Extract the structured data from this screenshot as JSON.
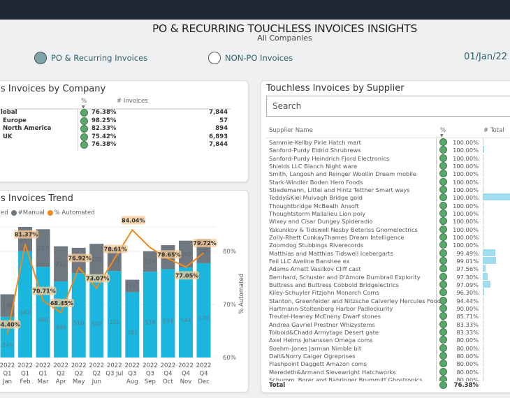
{
  "header": {
    "title": "PO & RECURRING TOUCHLESS INVOICES INSIGHTS",
    "subtitle": "All Companies",
    "date": "01/Jan/22"
  },
  "filters": [
    {
      "label": "PO & Recurring Invoices",
      "selected": true
    },
    {
      "label": "NON-PO Invoices",
      "selected": false
    }
  ],
  "company_panel": {
    "title": "s Invoices by Company",
    "col_pct": "%",
    "col_invoices": "# Invoices",
    "rows": [
      {
        "name": "lobal",
        "pct": "76.38%",
        "invoices": "7,844"
      },
      {
        "name": "Europe",
        "pct": "98.25%",
        "invoices": "57"
      },
      {
        "name": "North America",
        "pct": "82.33%",
        "invoices": "894"
      },
      {
        "name": "UK",
        "pct": "75.42%",
        "invoices": "6,893"
      },
      {
        "name": "",
        "pct": "76.38%",
        "invoices": "7,844"
      }
    ]
  },
  "trend_panel": {
    "title": "s Invoices Trend",
    "legend": [
      {
        "label": "ed",
        "color": "#1ab6dd"
      },
      {
        "label": "#Manual",
        "color": "#6f7880"
      },
      {
        "label": "% Automated",
        "color": "#f08a1c"
      }
    ]
  },
  "chart_data": {
    "type": "bar+line",
    "y2label": "% Automated",
    "y2ticks": [
      "60%",
      "70%",
      "80%"
    ],
    "y2lim": [
      60,
      85
    ],
    "categories": [
      [
        "2022",
        "Q1",
        "Jan"
      ],
      [
        "2022",
        "Q1",
        "Feb"
      ],
      [
        "2022",
        "Q1",
        "Mar"
      ],
      [
        "2022",
        "Q2",
        "Apr"
      ],
      [
        "2022",
        "Q2",
        "May"
      ],
      [
        "2022",
        "Q2",
        "Jun"
      ],
      [
        "2022",
        "Q3 Jul",
        ""
      ],
      [
        "2022",
        "Q3",
        "Aug"
      ],
      [
        "2022",
        "Q3",
        "Sep"
      ],
      [
        "2022",
        "Q4",
        "Oct"
      ],
      [
        "2022",
        "Q4",
        "Nov"
      ],
      [
        "2022",
        "Q4",
        "Dec"
      ]
    ],
    "series": [
      {
        "name": "#Automated",
        "type": "bar",
        "color": "#1ab6dd",
        "values": [
          246,
          642,
          548,
          460,
          510,
          502,
          522,
          395,
          518,
          534,
          544,
          570
        ]
      },
      {
        "name": "#Manual",
        "type": "bar",
        "color": "#6f7880",
        "values": [
          136,
          147,
          227,
          212,
          153,
          185,
          142,
          75,
          124,
          145,
          162,
          145
        ]
      },
      {
        "name": "% Automated",
        "type": "line",
        "color": "#f08a1c",
        "values": [
          64.4,
          81.37,
          70.71,
          68.45,
          76.92,
          73.07,
          78.61,
          84.04,
          80.69,
          78.65,
          77.05,
          79.72
        ],
        "labels": [
          "64.40%",
          "81.37%",
          "70.71%",
          "68.45%",
          "76.92%",
          "73.07%",
          "78.61%",
          "84.04%",
          null,
          "78.65%",
          "77.05%",
          "79.72%"
        ]
      }
    ]
  },
  "supplier_panel": {
    "title": "Touchless Invoices by Supplier",
    "search_placeholder": "Search",
    "col_name": "Supplier Name",
    "col_pct": "%",
    "col_total": "# Total",
    "rows": [
      {
        "name": "Sammie-Kellby Pirie Hatch mart",
        "pct": "100.00%",
        "bar": 0.01
      },
      {
        "name": "Sanford-Purdy Eldrid Shrubrews",
        "pct": "100.00%",
        "bar": 0.03
      },
      {
        "name": "Sanford-Purdy Heindrich Fjord Electronics",
        "pct": "100.00%",
        "bar": 0.01
      },
      {
        "name": "Shields LLC Blanch Night ware",
        "pct": "100.00%",
        "bar": 0.01
      },
      {
        "name": "Smith, Langosh and Reinger Woollin Dream mobile",
        "pct": "100.00%",
        "bar": 0.01
      },
      {
        "name": "Stark-Windler Boden Hero Foods",
        "pct": "100.00%",
        "bar": 0.01
      },
      {
        "name": "Stiedemann, Littel and Hintz Tetther Smart ways",
        "pct": "100.00%",
        "bar": 0.02
      },
      {
        "name": "Teddy&Kiel Mulvagh Bridge gold",
        "pct": "100.00%",
        "bar": 1.0
      },
      {
        "name": "Thoughtbridge McBeath Ansoft",
        "pct": "100.00%",
        "bar": 0.01
      },
      {
        "name": "Thoughtstorm Mallalieu Lion poly",
        "pct": "100.00%",
        "bar": 0.01
      },
      {
        "name": "Wixey and Cisar Dungey Spideradio",
        "pct": "100.00%",
        "bar": 0.01
      },
      {
        "name": "Yakunikov & Tidswell Nesby Beteriss Gnomelectrics",
        "pct": "100.00%",
        "bar": 0.01
      },
      {
        "name": "Zolly-Rhett ConkayThames Dream Intelligence",
        "pct": "100.00%",
        "bar": 0.01
      },
      {
        "name": "Zoomdog Stubbings Riverecords",
        "pct": "100.00%",
        "bar": 0.01
      },
      {
        "name": "Matthias and Matthias Tidswell Icebergarts",
        "pct": "99.49%",
        "bar": 0.3
      },
      {
        "name": "Feil LLC Aveline Banshee ex",
        "pct": "99.01%",
        "bar": 0.32
      },
      {
        "name": "Adams Arnatt Vasilkov Cliff cast",
        "pct": "97.56%",
        "bar": 0.06
      },
      {
        "name": "Bernhard, Schuster and D'Amore Dumbrall Explority",
        "pct": "97.30%",
        "bar": 0.12
      },
      {
        "name": "Buttress and Buttress Cobbold Bridgelectrics",
        "pct": "97.09%",
        "bar": 0.18
      },
      {
        "name": "Kiley-Schuyler Fitzjohn Monarch Coms",
        "pct": "96.30%",
        "bar": 0.03
      },
      {
        "name": "Stanton, Greenfelder and Nitzsche Calverley Hercules Foods",
        "pct": "94.44%",
        "bar": 0.02
      },
      {
        "name": "Hartmann-Stoltenberg Harbor Padlockurity",
        "pct": "90.00%",
        "bar": 0.01
      },
      {
        "name": "Treutel-Heaney McEneny Dwarf stones",
        "pct": "85.71%",
        "bar": 0.01
      },
      {
        "name": "Andrea Gavriel Prestner Whizystems",
        "pct": "83.33%",
        "bar": 0.01
      },
      {
        "name": "Toiboid&Chadd Armytage Desert gate",
        "pct": "83.33%",
        "bar": 0.01
      },
      {
        "name": "Axel Heims Johanssen Omega coms",
        "pct": "80.00%",
        "bar": 0.01
      },
      {
        "name": "Boehm-Jones Jarman Nimble bit",
        "pct": "80.00%",
        "bar": 0.01
      },
      {
        "name": "Dalt&Norry Caiger Ogreprises",
        "pct": "80.00%",
        "bar": 0.01
      },
      {
        "name": "Flashpoint Daggett Amazon coms",
        "pct": "80.00%",
        "bar": 0.01
      },
      {
        "name": "Meredeth&Armand Sievewright Hatchworks",
        "pct": "80.00%",
        "bar": 0.01
      },
      {
        "name": "Schumm, Borer and Bahringer Brummitt Ghostronics",
        "pct": "80.00%",
        "bar": 0.01
      }
    ],
    "total": {
      "label": "Total",
      "pct": "76.38%"
    }
  },
  "colors": {
    "good": "#5aa96b",
    "databar": "#9fdcef",
    "accent": "#2f5f6e"
  }
}
